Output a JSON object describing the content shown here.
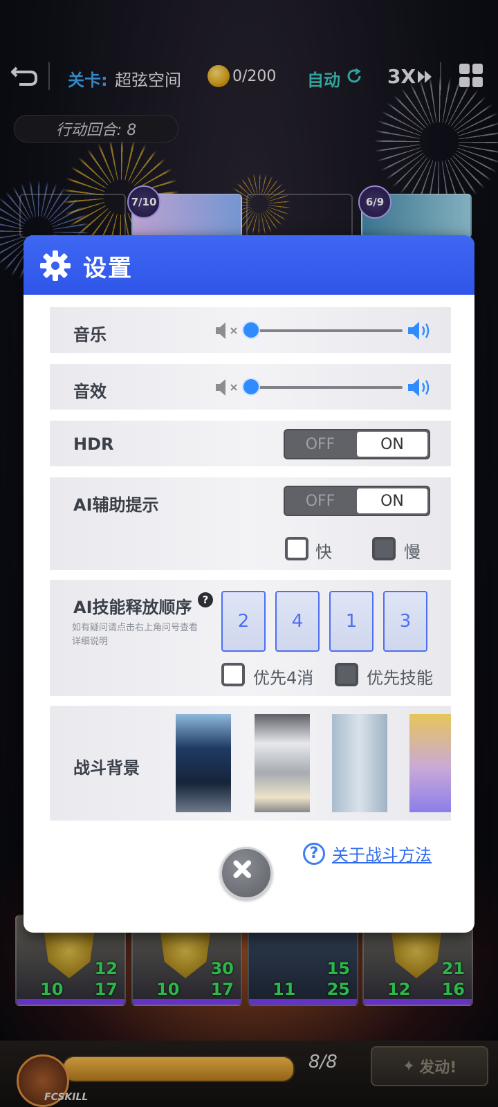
{
  "topbar": {
    "stage_label": "关卡:",
    "stage_name": "超弦空间",
    "coins": "0/200",
    "auto_label": "自动",
    "speed_label": "3X"
  },
  "battle": {
    "turn_text": "行动回合: 8",
    "enemy_badges": [
      "7/10",
      "6/9"
    ],
    "hero_cards": [
      {
        "def": "12",
        "atk": "10",
        "hp": "17"
      },
      {
        "def": "30",
        "atk": "10",
        "hp": "17"
      },
      {
        "def": "15",
        "atk": "11",
        "hp": "25"
      },
      {
        "def": "21",
        "atk": "12",
        "hp": "16"
      }
    ],
    "skill_brand": "FCSKILL",
    "energy_text": "8/8",
    "energy_fraction": 1.0,
    "launch_label": "发动!"
  },
  "settings": {
    "title": "设置",
    "music": {
      "label": "音乐",
      "level": 0
    },
    "sfx": {
      "label": "音效",
      "level": 0
    },
    "hdr": {
      "label": "HDR",
      "off": "OFF",
      "on": "ON",
      "value": "ON"
    },
    "ai_hint": {
      "label": "AI辅助提示",
      "off": "OFF",
      "on": "ON",
      "value": "ON",
      "fast_label": "快",
      "slow_label": "慢"
    },
    "ai_order": {
      "label": "AI技能释放顺序",
      "note": "如有疑问请点击右上角问号查看详细说明",
      "slots": [
        "2",
        "4",
        "1",
        "3"
      ],
      "prefer_match4_label": "优先4消",
      "prefer_skill_label": "优先技能"
    },
    "battle_bg": {
      "label": "战斗背景"
    },
    "help_link": "关于战斗方法"
  },
  "colors": {
    "header_blue": "#3e67f3",
    "slider_blue": "#2f8cff",
    "stat_green": "#35e05a",
    "auto_teal": "#3fc8c0",
    "stage_blue": "#3fa5f0"
  }
}
